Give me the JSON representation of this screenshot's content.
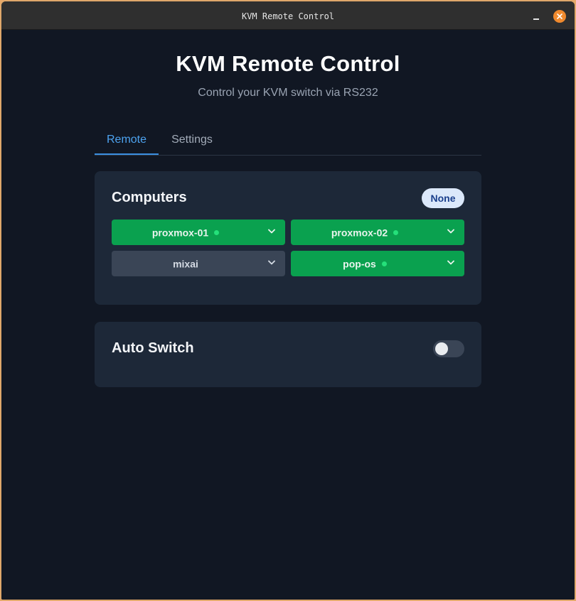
{
  "window": {
    "title": "KVM Remote Control"
  },
  "header": {
    "title": "KVM Remote Control",
    "subtitle": "Control your KVM switch via RS232"
  },
  "tabs": [
    {
      "label": "Remote",
      "active": true
    },
    {
      "label": "Settings",
      "active": false
    }
  ],
  "computers": {
    "heading": "Computers",
    "active_badge": "None",
    "items": [
      {
        "label": "proxmox-01",
        "online": true
      },
      {
        "label": "proxmox-02",
        "online": true
      },
      {
        "label": "mixai",
        "online": false
      },
      {
        "label": "pop-os",
        "online": true
      }
    ]
  },
  "auto_switch": {
    "label": "Auto Switch",
    "enabled": false
  },
  "colors": {
    "accent": "#3b8fe0",
    "online_button": "#0aa14f",
    "offline_button": "#3a4556",
    "status_dot": "#25e07a",
    "background": "#111723",
    "card": "#1d2838",
    "window_border": "#e0a86b",
    "close_button": "#f08a2e"
  },
  "icons": {
    "window_close": "close-icon",
    "window_minimize": "minimize-icon",
    "dropdown": "chevron-down-icon",
    "status": "status-dot-icon"
  }
}
